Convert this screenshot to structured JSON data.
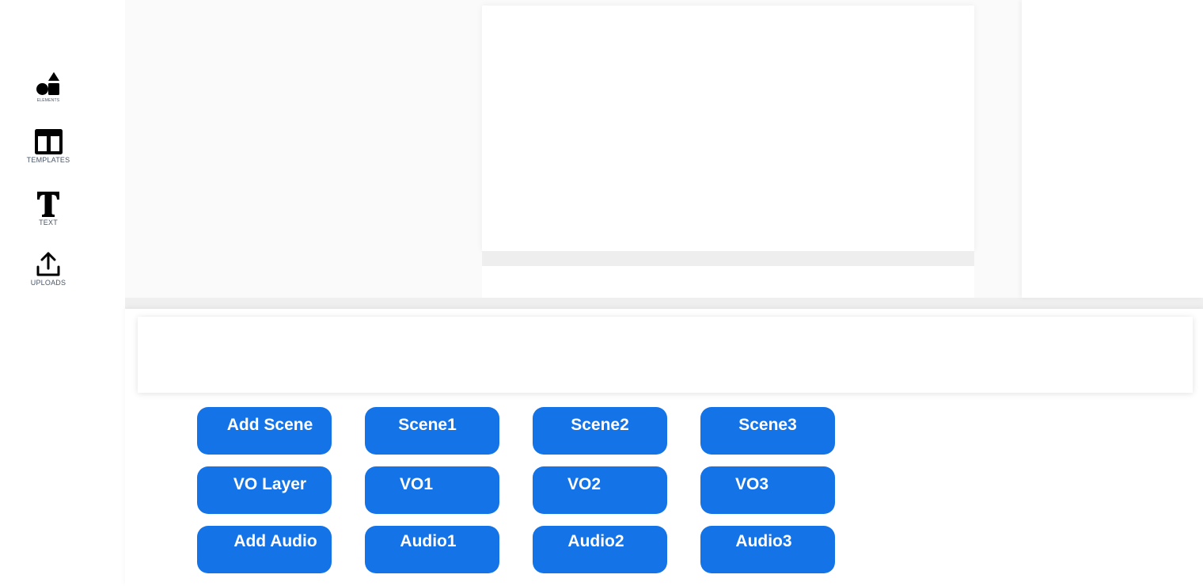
{
  "sidebar": {
    "items": [
      {
        "label": "ELEMENTS",
        "icon": "shapes-icon"
      },
      {
        "label": "TEMPLATES",
        "icon": "template-columns-icon"
      },
      {
        "label": "TEXT",
        "icon": "text-t-icon"
      },
      {
        "label": "UPLOADS",
        "icon": "upload-icon"
      }
    ]
  },
  "controls": {
    "scene_row": [
      "Add Scene",
      "Scene1",
      "Scene2",
      "Scene3"
    ],
    "vo_row": [
      "VO Layer",
      "VO1",
      "VO2",
      "VO3"
    ],
    "audio_row": [
      "Add Audio",
      "Audio1",
      "Audio2",
      "Audio3"
    ]
  },
  "colors": {
    "accent": "#1473e6",
    "workspace_bg": "#fafafa",
    "sidebar_label": "#4a5566"
  }
}
